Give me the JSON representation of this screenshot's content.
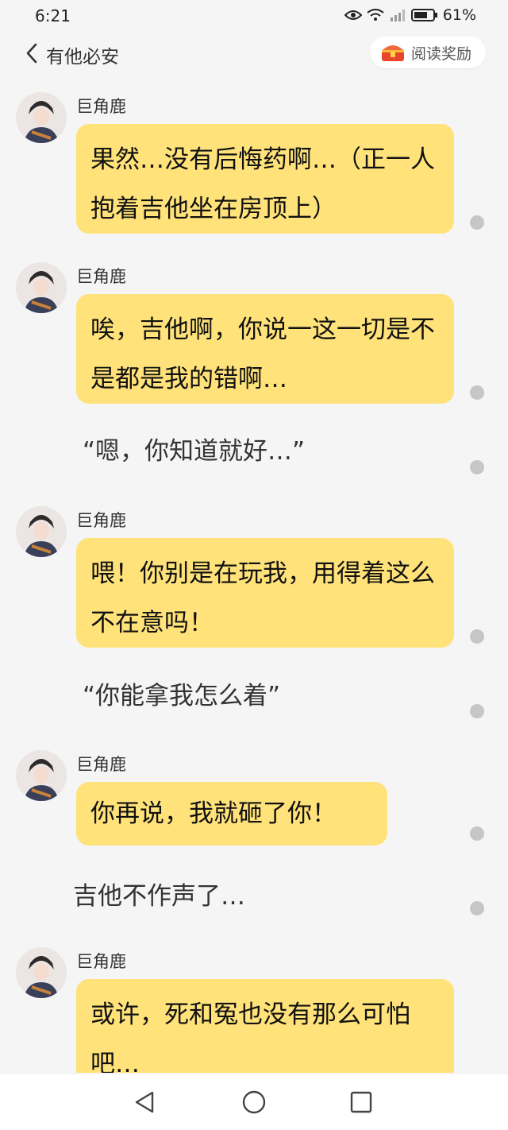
{
  "status": {
    "time": "6:21",
    "battery": "61%",
    "network": "4G"
  },
  "header": {
    "back_label": "有他必安",
    "reward_label": "阅读奖励"
  },
  "colors": {
    "bubble": "#ffe27a",
    "background": "#f5f5f5",
    "dot": "#c6c6c6"
  },
  "messages": [
    {
      "type": "bubble",
      "name": "巨角鹿",
      "text": "果然…没有后悔药啊…（正一人抱着吉他坐在房顶上）"
    },
    {
      "type": "bubble",
      "name": "巨角鹿",
      "text": "唉，吉他啊，你说一这一切是不是都是我的错啊…"
    },
    {
      "type": "narration",
      "text": "“嗯，你知道就好…”"
    },
    {
      "type": "bubble",
      "name": "巨角鹿",
      "text": "喂！你别是在玩我，用得着这么不在意吗！"
    },
    {
      "type": "narration",
      "text": "“你能拿我怎么着”"
    },
    {
      "type": "bubble",
      "name": "巨角鹿",
      "text": "你再说，我就砸了你！"
    },
    {
      "type": "narration",
      "text": "吉他不作声了…"
    },
    {
      "type": "bubble",
      "name": "巨角鹿",
      "text": "或许，死和冤也没有那么可怕吧…"
    }
  ]
}
